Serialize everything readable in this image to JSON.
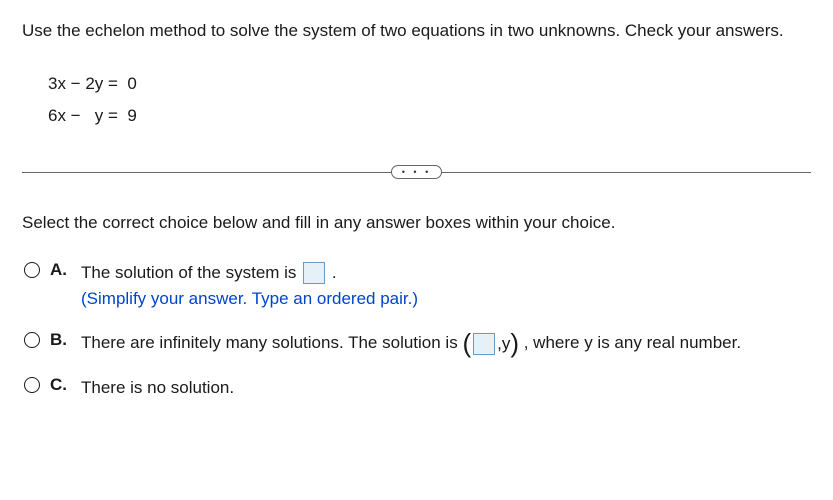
{
  "question": "Use the echelon method to solve the system of two equations in two unknowns. Check your answers.",
  "equations": {
    "line1": "3x − 2y =  0",
    "line2": "6x −   y =  9"
  },
  "divider_dots": "• • •",
  "instruction": "Select the correct choice below and fill in any answer boxes within your choice.",
  "choices": {
    "a": {
      "label": "A.",
      "text_before": "The solution of the system is ",
      "text_after": " .",
      "hint": "(Simplify your answer. Type an ordered pair.)"
    },
    "b": {
      "label": "B.",
      "text_before": "There are infinitely many solutions. The solution is ",
      "paren_open": "(",
      "inner_after": ",y",
      "paren_close": ")",
      "text_after": " , where y is any real number."
    },
    "c": {
      "label": "C.",
      "text": "There is no solution."
    }
  }
}
